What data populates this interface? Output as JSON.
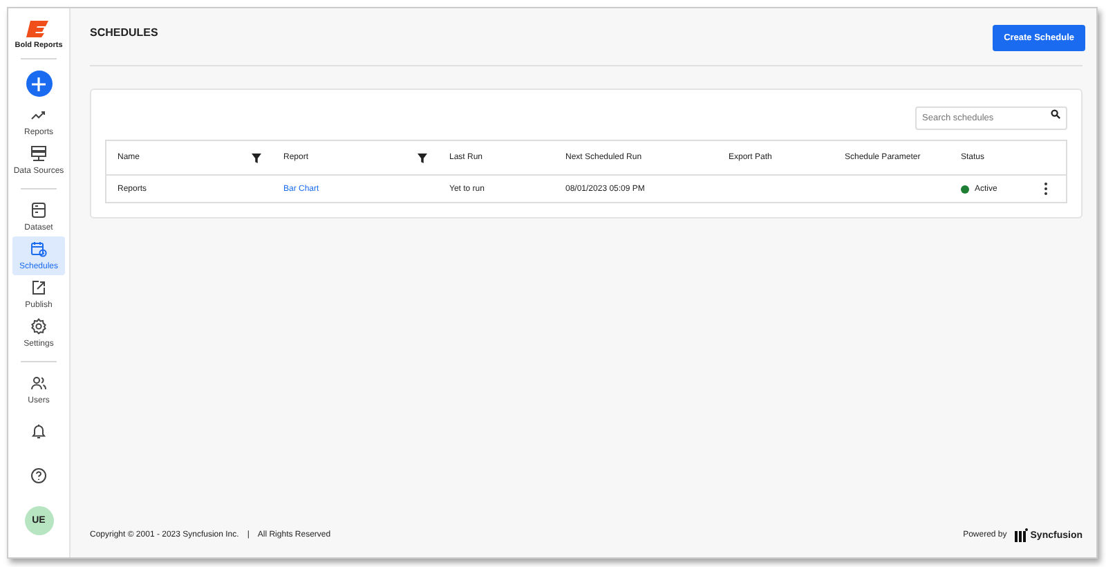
{
  "brand": {
    "name": "Bold Reports"
  },
  "sidebar": {
    "items": [
      {
        "kind": "add",
        "selected": false
      },
      {
        "kind": "nav",
        "label": "Reports",
        "selected": false
      },
      {
        "kind": "nav",
        "label": "Data Sources",
        "selected": false
      },
      {
        "kind": "divider"
      },
      {
        "kind": "nav",
        "label": "Dataset",
        "selected": false
      },
      {
        "kind": "nav",
        "label": "Schedules",
        "selected": true
      },
      {
        "kind": "nav",
        "label": "Publish",
        "selected": false
      },
      {
        "kind": "nav",
        "label": "Settings",
        "selected": false
      },
      {
        "kind": "divider"
      },
      {
        "kind": "nav",
        "label": "Users",
        "selected": false
      }
    ],
    "avatar": "UE"
  },
  "page": {
    "title": "SCHEDULES",
    "action": "Create Schedule"
  },
  "search": {
    "placeholder": "Search schedules"
  },
  "table": {
    "columns": [
      {
        "label": "Name",
        "filter": true
      },
      {
        "label": "Report",
        "filter": true
      },
      {
        "label": "Last Run",
        "filter": false
      },
      {
        "label": "Next Scheduled Run",
        "filter": false
      },
      {
        "label": "Export Path",
        "filter": false
      },
      {
        "label": "Schedule Parameter",
        "filter": false
      },
      {
        "label": "Status",
        "filter": false
      }
    ],
    "rows": [
      {
        "name": "Reports",
        "report": "Bar Chart",
        "last_run": "Yet to run",
        "next_run": "08/01/2023 05:09 PM",
        "status": "Active",
        "color": "#1e7e34"
      }
    ]
  },
  "footer": {
    "copyright": "Copyright © 2001 - 2023 Syncfusion Inc.",
    "separator": "|",
    "rights": "All Rights Reserved",
    "powered": "Powered by",
    "brand": "Syncfusion"
  }
}
